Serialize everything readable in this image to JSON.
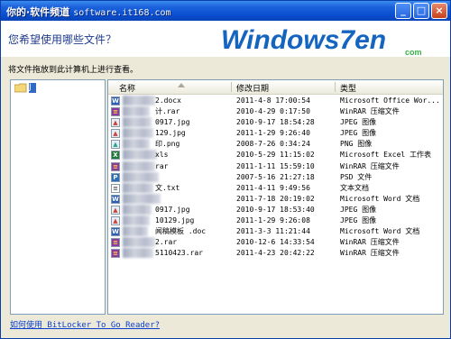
{
  "window": {
    "title": "你的·软件频道",
    "watermark": "software.it168.com"
  },
  "header": {
    "prompt": "您希望使用哪些文件？",
    "logo_text": "Windows7en",
    "logo_subtext": "com"
  },
  "instruction": "将文件拖放到此计算机上进行查看。",
  "folder_pane": {
    "selected_label": "J"
  },
  "list": {
    "columns": {
      "name": "名称",
      "modified": "修改日期",
      "type": "类型"
    },
    "rows": [
      {
        "name": "2.docx",
        "modified": "2011-4-8 17:00:54",
        "type": "Microsoft Office Wor...",
        "icon": "word-doc-icon"
      },
      {
        "name": "计.rar",
        "modified": "2010-4-29 0:17:50",
        "type": "WinRAR 压缩文件",
        "icon": "rar-icon"
      },
      {
        "name": "0917.jpg",
        "modified": "2010-9-17 18:54:28",
        "type": "JPEG 图像",
        "icon": "jpeg-icon"
      },
      {
        "name": "129.jpg",
        "modified": "2011-1-29 9:26:40",
        "type": "JPEG 图像",
        "icon": "jpeg-icon"
      },
      {
        "name": "印.png",
        "modified": "2008-7-26 0:34:24",
        "type": "PNG 图像",
        "icon": "png-icon"
      },
      {
        "name": "xls",
        "modified": "2010-5-29 11:15:02",
        "type": "Microsoft Excel 工作表",
        "icon": "excel-icon"
      },
      {
        "name": "rar",
        "modified": "2011-1-11 15:59:10",
        "type": "WinRAR 压缩文件",
        "icon": "rar-icon"
      },
      {
        "name": "",
        "modified": "2007-5-16 21:27:18",
        "type": "PSD 文件",
        "icon": "psd-icon"
      },
      {
        "name": "文.txt",
        "modified": "2011-4-11 9:49:56",
        "type": "文本文档",
        "icon": "text-icon"
      },
      {
        "name": "",
        "modified": "2011-7-18 20:19:02",
        "type": "Microsoft Word 文档",
        "icon": "word-doc-icon"
      },
      {
        "name": "0917.jpg",
        "modified": "2010-9-17 18:53:40",
        "type": "JPEG 图像",
        "icon": "jpeg-icon"
      },
      {
        "name": "10129.jpg",
        "modified": "2011-1-29 9:26:08",
        "type": "JPEG 图像",
        "icon": "jpeg-icon"
      },
      {
        "name": "闻稿模板 .doc",
        "modified": "2011-3-3 11:21:44",
        "type": "Microsoft Word 文档",
        "icon": "word-doc-icon"
      },
      {
        "name": "2.rar",
        "modified": "2010-12-6 14:33:54",
        "type": "WinRAR 压缩文件",
        "icon": "rar-icon"
      },
      {
        "name": "5110423.rar",
        "modified": "2011-4-23 20:42:22",
        "type": "WinRAR 压缩文件",
        "icon": "rar-icon"
      }
    ]
  },
  "footer_link": "如何使用 BitLocker To Go Reader?",
  "colors": {
    "title_bar": "#0a4fd0",
    "link": "#0b3fd0",
    "logo_blue": "#1565c0",
    "logo_green": "#3bb14a"
  }
}
